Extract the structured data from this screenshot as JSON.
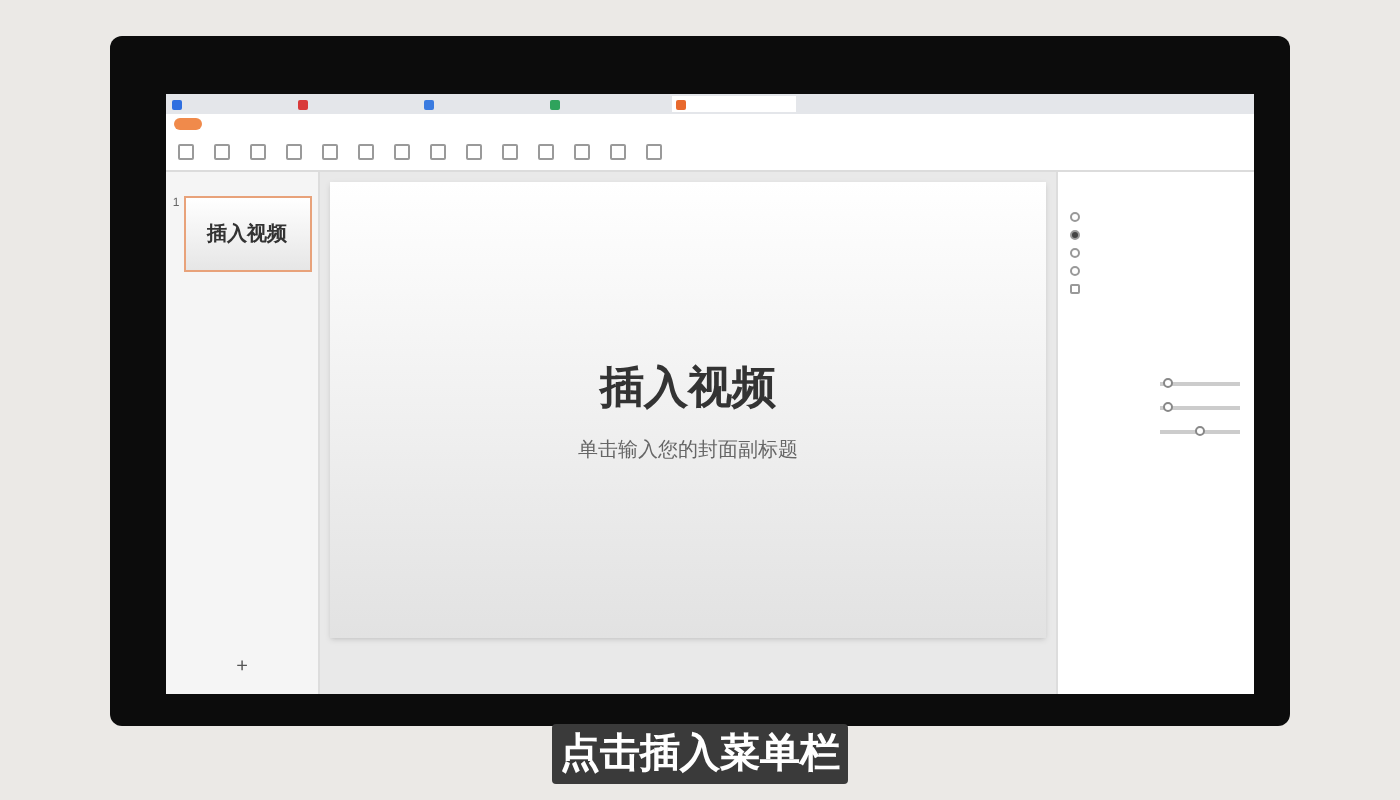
{
  "window_tabs": [
    {
      "selected": false,
      "color": "#2f6fe0"
    },
    {
      "selected": false,
      "color": "#d93a3a"
    },
    {
      "selected": false,
      "color": "#3a7be0"
    },
    {
      "selected": false,
      "color": "#2fa35c"
    },
    {
      "selected": true,
      "color": "#e8692d"
    }
  ],
  "slide_panel": {
    "slides": [
      {
        "number": "1",
        "title": "插入视频",
        "selected": true
      }
    ],
    "add_button": "+"
  },
  "slide": {
    "title": "插入视频",
    "subtitle": "单击输入您的封面副标题"
  },
  "properties_panel": {
    "fill_options": [
      {
        "selected": false,
        "kind": "radio"
      },
      {
        "selected": true,
        "kind": "radio"
      },
      {
        "selected": false,
        "kind": "radio"
      },
      {
        "selected": false,
        "kind": "radio"
      },
      {
        "selected": false,
        "kind": "checkbox"
      }
    ],
    "sliders": [
      {
        "level": 0.1
      },
      {
        "level": 0.1
      },
      {
        "level": 0.5
      }
    ]
  },
  "caption": "点击插入菜单栏"
}
